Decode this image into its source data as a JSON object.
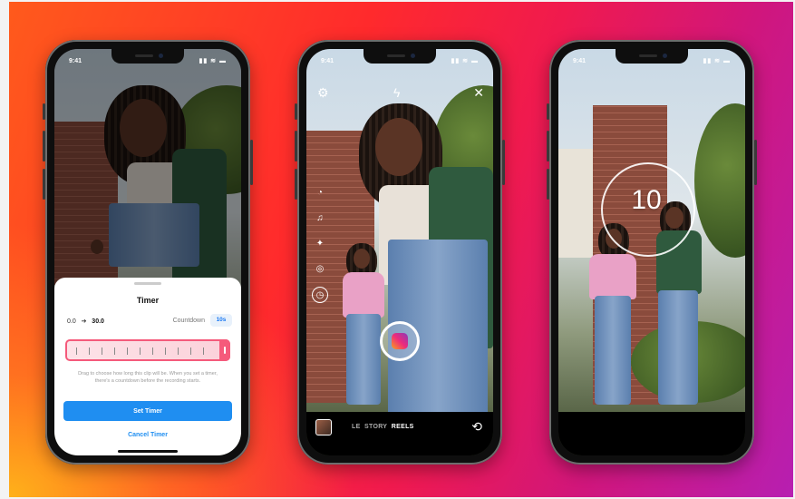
{
  "phones": {
    "timer": {
      "status_time": "9:41",
      "status_icons": "▮▮ ≋ ▬",
      "sheet_title": "Timer",
      "range_start": "0.0",
      "range_arrow": "➔",
      "range_end": "30.0",
      "countdown_label": "Countdown",
      "countdown_value": "10s",
      "help_text": "Drag to choose how long this clip will be. When you set a timer, there's a countdown before the recording starts.",
      "set_timer_label": "Set Timer",
      "cancel_timer_label": "Cancel Timer"
    },
    "camera": {
      "status_time": "9:41",
      "status_icons": "▮▮ ≋ ▬",
      "modes_partial": "LE",
      "mode_story": "STORY",
      "mode_reels": "REELS",
      "rail_icons": [
        "speed-icon",
        "music-icon",
        "effects-icon",
        "align-icon",
        "timer-icon"
      ]
    },
    "countdown": {
      "status_time": "9:41",
      "status_icons": "▮▮ ≋ ▬",
      "count": "10"
    }
  },
  "colors": {
    "accent_blue": "#1f8ef1",
    "scrubber_pink": "#f55a7b",
    "gradient_start": "#ffb11a",
    "gradient_end": "#b71fb1"
  }
}
